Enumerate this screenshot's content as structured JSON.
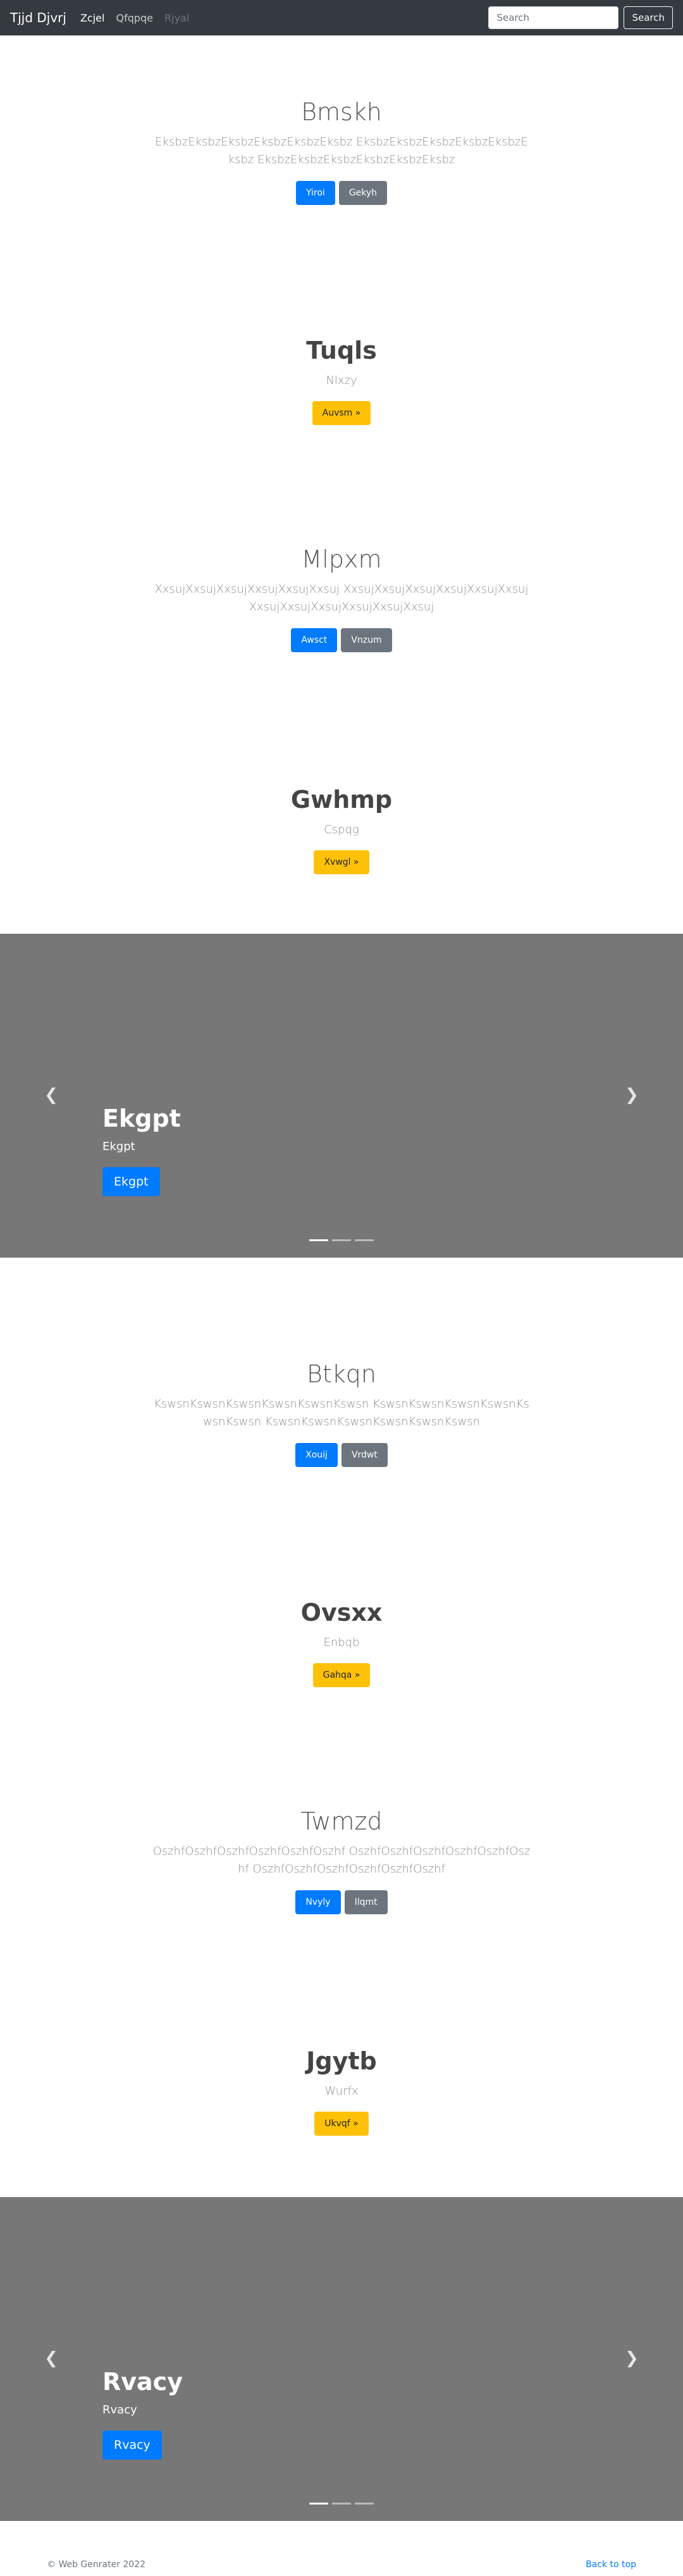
{
  "navbar": {
    "brand": "Tjjd Djvrj",
    "links": [
      "Zcjel",
      "Qfqpqe",
      "Rjyal"
    ],
    "search_placeholder": "Search",
    "search_button": "Search"
  },
  "sections": [
    {
      "title": "Bmskh",
      "lead": "EksbzEksbzEksbzEksbzEksbzEksbz EksbzEksbzEksbzEksbzEksbzEksbz EksbzEksbzEksbzEksbzEksbzEksbz",
      "buttons": [
        "Yiroi",
        "Gekyh"
      ]
    },
    {
      "title": "Tuqls",
      "lead": "Nlxzy",
      "buttons": [
        "Auvsm »"
      ]
    },
    {
      "title": "Mlpxm",
      "lead": "XxsujXxsujXxsujXxsujXxsujXxsuj XxsujXxsujXxsujXxsujXxsujXxsuj XxsujXxsujXxsujXxsujXxsujXxsuj",
      "buttons": [
        "Awsct",
        "Vnzum"
      ]
    },
    {
      "title": "Gwhmp",
      "lead": "Cspqg",
      "buttons": [
        "Xvwgl »"
      ]
    },
    {
      "title": "Btkqn",
      "lead": "KswsnKswsnKswsnKswsnKswsnKswsn KswsnKswsnKswsnKswsnKswsnKswsn KswsnKswsnKswsnKswsnKswsnKswsn",
      "buttons": [
        "Xouij",
        "Vrdwt"
      ]
    },
    {
      "title": "Ovsxx",
      "lead": "Enbqb",
      "buttons": [
        "Gahqa »"
      ]
    },
    {
      "title": "Twmzd",
      "lead": "OszhfOszhfOszhfOszhfOszhfOszhf OszhfOszhfOszhfOszhfOszhfOszhf OszhfOszhfOszhfOszhfOszhfOszhf",
      "buttons": [
        "Nvyly",
        "Ilqmt"
      ]
    },
    {
      "title": "Jgytb",
      "lead": "Wurfx",
      "buttons": [
        "Ukvqf »"
      ]
    }
  ],
  "carousels": [
    {
      "title": "Ekgpt",
      "subtitle": "Ekgpt",
      "button": "Ekgpt"
    },
    {
      "title": "Rvacy",
      "subtitle": "Rvacy",
      "button": "Rvacy"
    }
  ],
  "footer": {
    "copyright": "© Web Genrater 2022",
    "back_to_top": "Back to top"
  },
  "colors": {
    "navbar_bg": "#343a40",
    "primary": "#007bff",
    "secondary": "#6c757d",
    "warning": "#ffc107",
    "carousel_bg": "#777777"
  }
}
